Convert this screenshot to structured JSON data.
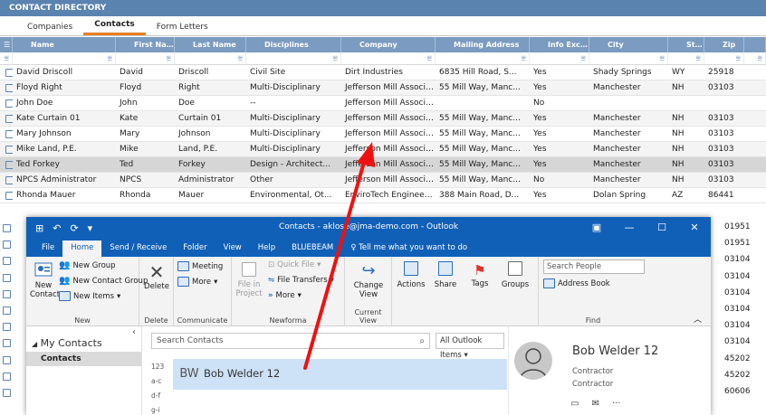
{
  "directory": {
    "title": "CONTACT DIRECTORY",
    "tabs": [
      {
        "label": "Companies"
      },
      {
        "label": "Contacts"
      },
      {
        "label": "Form Letters"
      }
    ],
    "columns": [
      "Name",
      "First Name",
      "Last Name",
      "Disciplines",
      "Company",
      "Mailing Address",
      "Info Exchange User",
      "City",
      "State",
      "Zip"
    ],
    "rows": [
      [
        "David Driscoll",
        "David",
        "Driscoll",
        "Civil Site",
        "Dirt Industries",
        "6835 Hill Road, S...",
        "Yes",
        "Shady Springs",
        "WY",
        "25918"
      ],
      [
        "Floyd Right",
        "Floyd",
        "Right",
        "Multi-Disciplinary",
        "Jefferson Mill Associat...",
        "55 Mill Way, Manc...",
        "Yes",
        "Manchester",
        "NH",
        "03103"
      ],
      [
        "John Doe",
        "John",
        "Doe",
        "--",
        "Jefferson Mill Associat...",
        "",
        "No",
        "",
        "",
        ""
      ],
      [
        "Kate Curtain 01",
        "Kate",
        "Curtain 01",
        "Multi-Disciplinary",
        "Jefferson Mill Associat...",
        "55 Mill Way, Manc...",
        "Yes",
        "Manchester",
        "NH",
        "03103"
      ],
      [
        "Mary Johnson",
        "Mary",
        "Johnson",
        "Multi-Disciplinary",
        "Jefferson Mill Associat...",
        "55 Mill Way, Manc...",
        "Yes",
        "Manchester",
        "NH",
        "03103"
      ],
      [
        "Mike Land, P.E.",
        "Mike",
        "Land, P.E.",
        "Multi-Disciplinary",
        "Jefferson Mill Associat...",
        "55 Mill Way, Manc...",
        "Yes",
        "Manchester",
        "NH",
        "03103"
      ],
      [
        "Ted Forkey",
        "Ted",
        "Forkey",
        "Design - Architect...",
        "Jefferson Mill Associat...",
        "55 Mill Way, Manc...",
        "Yes",
        "Manchester",
        "NH",
        "03103"
      ],
      [
        "NPCS Administrator",
        "NPCS",
        "Administrator",
        "Other",
        "Jefferson Mill Associat...",
        "55 Mill Way, Manc...",
        "No",
        "Manchester",
        "NH",
        "03103"
      ],
      [
        "Rhonda Mauer",
        "Rhonda",
        "Mauer",
        "Environmental, Ot...",
        "EnviroTech Engineering",
        "388 Main Road, D...",
        "Yes",
        "Dolan Spring",
        "AZ",
        "86441"
      ]
    ],
    "hidden_zips": [
      "01951",
      "01951",
      "03104",
      "03104",
      "03104",
      "03104",
      "03104",
      "03104",
      "45202",
      "45202",
      "60606"
    ]
  },
  "outlook": {
    "caption": "Contacts - aklose@jma-demo.com - Outlook",
    "tabs": [
      "File",
      "Home",
      "Send / Receive",
      "Folder",
      "View",
      "Help",
      "BLUEBEAM"
    ],
    "tell_me": "Tell me what you want to do",
    "ribbon": {
      "new_group": "New Group",
      "new_contact_group": "New Contact Group",
      "new_contact": "New Contact",
      "new_items": "New Items",
      "group_new": "New",
      "delete": "Delete",
      "group_delete": "Delete",
      "meeting": "Meeting",
      "more": "More",
      "group_communicate": "Communicate",
      "file_in_project": "File in Project",
      "quick_file": "Quick File",
      "file_transfers": "File Transfers",
      "more2": "More",
      "group_newforma": "Newforma",
      "change_view": "Change View",
      "group_current_view": "Current View",
      "actions": "Actions",
      "share": "Share",
      "tags": "Tags",
      "groups": "Groups",
      "search_people": "Search People",
      "address_book": "Address Book",
      "group_find": "Find"
    },
    "nav": {
      "my_contacts": "My Contacts",
      "contacts": "Contacts"
    },
    "list": {
      "search_placeholder": "Search Contacts",
      "scope": "All Outlook Items",
      "alpha": [
        "123",
        "a-c",
        "d-f",
        "g-i"
      ],
      "initials": "BW",
      "contact_name": "Bob Welder 12"
    },
    "reading": {
      "name": "Bob Welder 12",
      "title": "Contractor",
      "company": "Contractor"
    }
  },
  "colors": {
    "directory_title": "#5b83b0",
    "header": "#7b9bc0",
    "outlook_blue": "#1160b8",
    "selection": "#cde1f7",
    "arrow": "#ee1111"
  }
}
